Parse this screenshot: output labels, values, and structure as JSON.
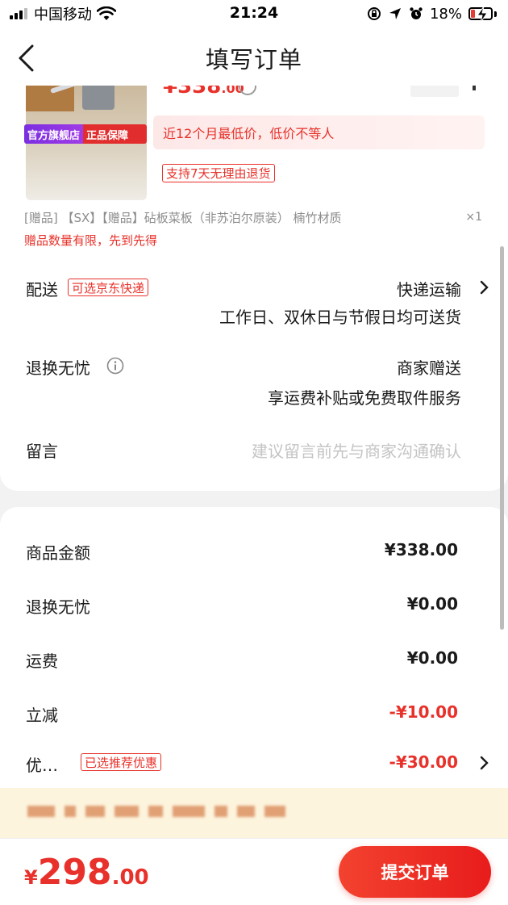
{
  "status_bar": {
    "carrier": "中国移动",
    "time": "21:24",
    "battery_percent": "18%"
  },
  "nav": {
    "title": "填写订单"
  },
  "product": {
    "shop_badge_official": "官方旗舰店",
    "shop_badge_genuine": "正品保障",
    "price_partial": "¥338",
    "price_partial_decimal": ".00",
    "lowest_price_note": "近12个月最低价，低价不等人",
    "return_tag": "支持7天无理由退货"
  },
  "gift": {
    "description": "[赠品] 【SX】【赠品】砧板菜板（非苏泊尔原装） 楠竹材质",
    "quantity": "×1",
    "note": "赠品数量有限，先到先得"
  },
  "delivery": {
    "label": "配送",
    "tag": "可选京东快递",
    "method": "快递运输",
    "schedule": "工作日、双休日与节假日均可送货"
  },
  "return_worry_free": {
    "label": "退换无忧",
    "value": "商家赠送",
    "sub": "享运费补贴或免费取件服务"
  },
  "message": {
    "label": "留言",
    "placeholder": "建议留言前先与商家沟通确认"
  },
  "summary": {
    "rows": [
      {
        "label": "商品金额",
        "value": "¥338.00"
      },
      {
        "label": "退换无忧",
        "value": "¥0.00"
      },
      {
        "label": "运费",
        "value": "¥0.00"
      },
      {
        "label": "立减",
        "value": "-¥10.00"
      },
      {
        "label": "优…",
        "value": "-¥30.00",
        "tag": "已选推荐优惠"
      }
    ]
  },
  "bottom": {
    "currency": "¥",
    "total_int": "298",
    "total_dec": ".00",
    "submit_label": "提交订单"
  },
  "colors": {
    "accent_red": "#e8312a",
    "promo_strip_bg": "#fdf4dd",
    "page_bg": "#f2f2f2"
  }
}
